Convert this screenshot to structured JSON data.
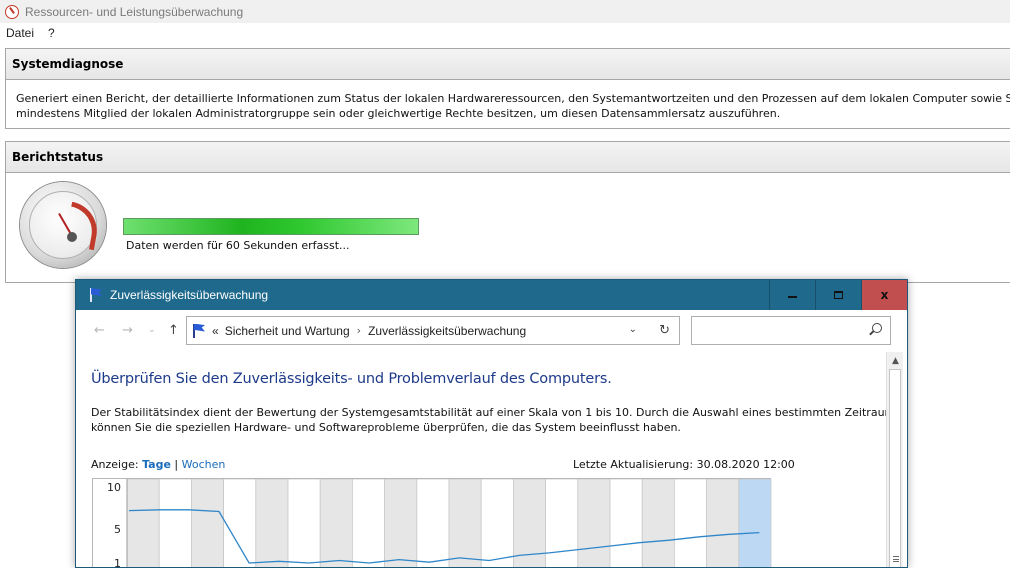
{
  "resource_monitor": {
    "title": "Ressourcen- und Leistungsüberwachung",
    "menu": [
      "Datei",
      "?"
    ],
    "system_diagnosis": {
      "heading": "Systemdiagnose",
      "description_line1": "Generiert einen Bericht, der detaillierte Informationen zum Status der lokalen Hardwareressourcen, den Systemantwortzeiten und den Prozessen auf dem lokalen Computer sowie Systeminform",
      "description_line2": "mindestens Mitglied der lokalen Administratorgruppe sein oder gleichwertige Rechte besitzen, um diesen Datensammlersatz auszuführen."
    },
    "report_status": {
      "heading": "Berichtstatus",
      "progress_fraction": 1.0,
      "progress_text": "Daten werden für 60 Sekunden erfasst..."
    }
  },
  "reliability_window": {
    "title": "Zuverlässigkeitsüberwachung",
    "window_buttons": {
      "minimize": "minimize",
      "maximize": "maximize",
      "close": "x"
    },
    "nav": {
      "back": "←",
      "forward": "→",
      "recent": "⌄",
      "up": "↑"
    },
    "address": {
      "chevron": "«",
      "crumbs": [
        "Sicherheit und Wartung",
        "Zuverlässigkeitsüberwachung"
      ],
      "separator": "›",
      "dropdown": "⌄",
      "refresh": "↻"
    },
    "search": {
      "placeholder": ""
    },
    "heading": "Überprüfen Sie den Zuverlässigkeits- und Problemverlauf des Computers.",
    "description_line1": "Der Stabilitätsindex dient der Bewertung der Systemgesamtstabilität auf einer Skala von 1 bis 10. Durch die Auswahl eines bestimmten Zeitraums",
    "description_line2": "können Sie die speziellen Hardware- und Softwareprobleme überprüfen, die das System beeinflusst haben.",
    "view": {
      "label": "Anzeige:",
      "days": "Tage",
      "separator": "|",
      "weeks": "Wochen"
    },
    "last_update": "Letzte Aktualisierung: 30.08.2020 12:00"
  },
  "chart_data": {
    "type": "line",
    "y_ticks": [
      "10",
      "5",
      "1"
    ],
    "ylim": [
      1,
      10
    ],
    "columns": 20,
    "shaded_columns": [
      1,
      3,
      5,
      7,
      9,
      11,
      13,
      15,
      17,
      19
    ],
    "selected_column": 20,
    "series": [
      {
        "values": [
          7.2,
          7.3,
          7.3,
          7.1,
          1.0,
          1.2,
          1.0,
          1.3,
          1.0,
          1.4,
          1.1,
          1.6,
          1.3,
          1.9,
          2.2,
          2.6,
          3.0,
          3.4,
          3.7,
          4.1,
          4.4,
          4.6
        ]
      }
    ],
    "grid": true
  },
  "colors": {
    "rel_titlebar": "#1f6a8c",
    "close_button": "#c14f4f",
    "heading_blue": "#1e3a8a",
    "line": "#2f86c9",
    "selected_column": "#bcd8f2",
    "shaded_column": "#e6e6e6",
    "progress": "#2fc82f"
  }
}
